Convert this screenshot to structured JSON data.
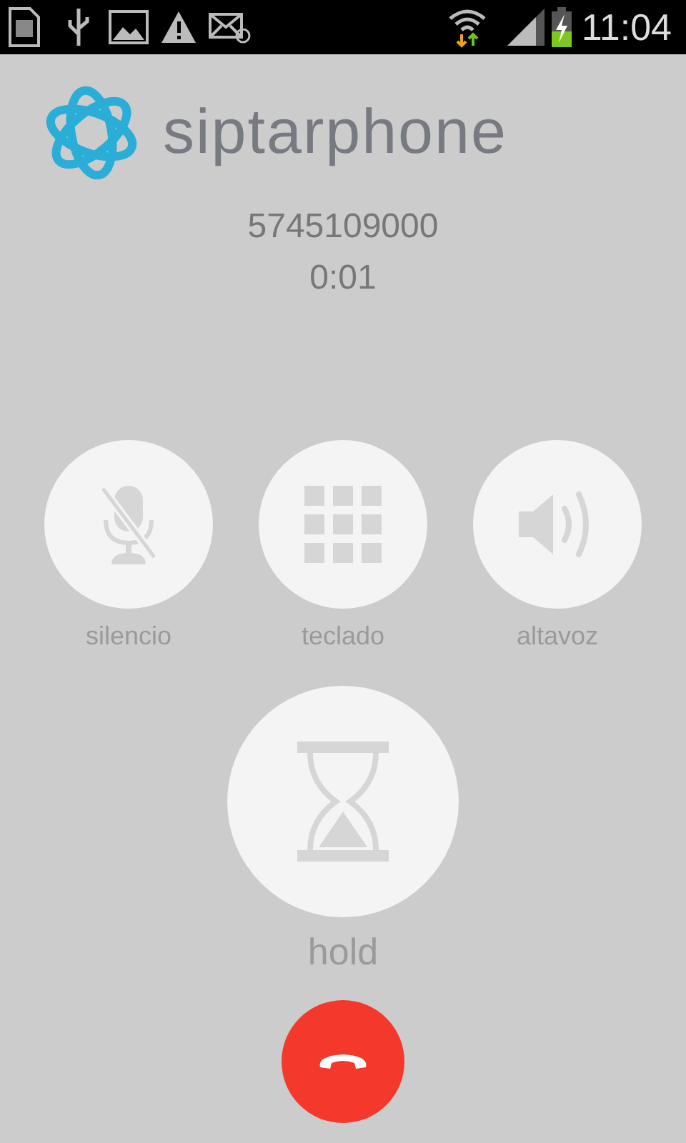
{
  "status_bar": {
    "time": "11:04"
  },
  "logo": {
    "text": "siptarphone"
  },
  "call": {
    "number": "5745109000",
    "duration": "0:01"
  },
  "controls": [
    {
      "kind": "mute",
      "label": "silencio"
    },
    {
      "kind": "keypad",
      "label": "teclado"
    },
    {
      "kind": "speaker",
      "label": "altavoz"
    }
  ],
  "hold": {
    "label": "hold"
  }
}
